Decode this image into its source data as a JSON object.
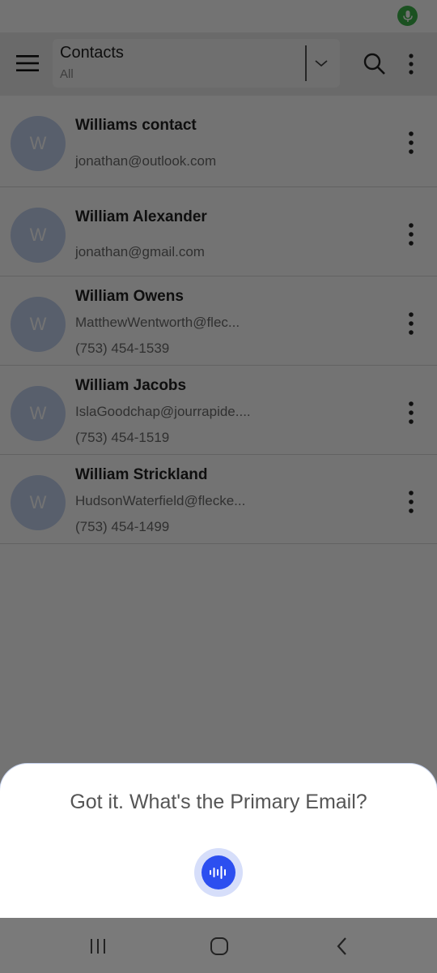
{
  "status_bar": {
    "mic_icon": "microphone-icon",
    "mic_color": "#3db34a"
  },
  "app_bar": {
    "menu_icon": "hamburger-menu-icon",
    "title": "Contacts",
    "filter": "All",
    "dropdown_icon": "chevron-down-icon",
    "search_icon": "search-icon",
    "more_icon": "more-vertical-icon"
  },
  "contacts": [
    {
      "initial": "W",
      "name": "Williams contact",
      "line1": "jonathan@outlook.com",
      "line2": ""
    },
    {
      "initial": "W",
      "name": "William Alexander",
      "line1": "jonathan@gmail.com",
      "line2": ""
    },
    {
      "initial": "W",
      "name": "William Owens",
      "line1": "MatthewWentworth@flec...",
      "line2": "(753) 454-1539"
    },
    {
      "initial": "W",
      "name": "William Jacobs",
      "line1": "IslaGoodchap@jourrapide....",
      "line2": "(753) 454-1519"
    },
    {
      "initial": "W",
      "name": "William Strickland",
      "line1": "HudsonWaterfield@flecke...",
      "line2": "(753) 454-1499"
    }
  ],
  "voice_sheet": {
    "prompt": "Got it. What's the Primary Email?",
    "button_icon": "voice-waveform-icon",
    "accent": "#2c4ff0"
  },
  "nav_bar": {
    "recents_icon": "recent-apps-icon",
    "home_icon": "home-icon",
    "back_icon": "back-icon"
  }
}
